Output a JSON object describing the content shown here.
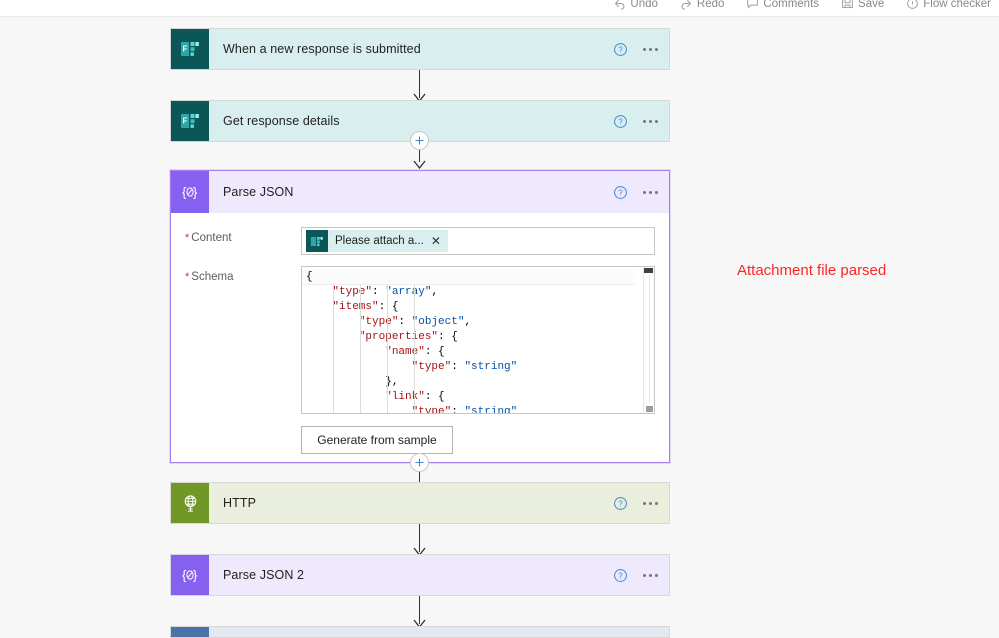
{
  "toolbar": {
    "items": [
      {
        "label": "Undo",
        "icon": "undo-icon"
      },
      {
        "label": "Redo",
        "icon": "redo-icon"
      },
      {
        "label": "Comments",
        "icon": "comment-icon"
      },
      {
        "label": "Save",
        "icon": "save-icon"
      },
      {
        "label": "Flow checker",
        "icon": "flow-checker-icon"
      }
    ]
  },
  "flow": {
    "steps": [
      {
        "title": "When a new response is submitted",
        "icon": "microsoft-forms-icon",
        "type": "forms"
      },
      {
        "title": "Get response details",
        "icon": "microsoft-forms-icon",
        "type": "forms"
      },
      {
        "title": "Parse JSON",
        "icon": "parse-json-icon",
        "type": "json"
      },
      {
        "title": "HTTP",
        "icon": "http-globe-icon",
        "type": "http"
      },
      {
        "title": "Parse JSON 2",
        "icon": "parse-json-icon",
        "type": "json"
      }
    ],
    "help_tooltip": "?",
    "more_menu": "..."
  },
  "parse_json": {
    "title": "Parse JSON",
    "content_label": "Content",
    "schema_label": "Schema",
    "required_marker": "*",
    "token": {
      "text": "Please attach a...",
      "remove": "✕",
      "icon": "microsoft-forms-icon"
    },
    "schema_lines": [
      [
        {
          "t": "{",
          "c": "p"
        }
      ],
      [
        {
          "t": "    ",
          "c": "p"
        },
        {
          "t": "\"type\"",
          "c": "k"
        },
        {
          "t": ": ",
          "c": "p"
        },
        {
          "t": "\"array\"",
          "c": "v"
        },
        {
          "t": ",",
          "c": "p"
        }
      ],
      [
        {
          "t": "    ",
          "c": "p"
        },
        {
          "t": "\"items\"",
          "c": "k"
        },
        {
          "t": ": {",
          "c": "p"
        }
      ],
      [
        {
          "t": "        ",
          "c": "p"
        },
        {
          "t": "\"type\"",
          "c": "k"
        },
        {
          "t": ": ",
          "c": "p"
        },
        {
          "t": "\"object\"",
          "c": "v"
        },
        {
          "t": ",",
          "c": "p"
        }
      ],
      [
        {
          "t": "        ",
          "c": "p"
        },
        {
          "t": "\"properties\"",
          "c": "k"
        },
        {
          "t": ": {",
          "c": "p"
        }
      ],
      [
        {
          "t": "            ",
          "c": "p"
        },
        {
          "t": "\"name\"",
          "c": "k"
        },
        {
          "t": ": {",
          "c": "p"
        }
      ],
      [
        {
          "t": "                ",
          "c": "p"
        },
        {
          "t": "\"type\"",
          "c": "k"
        },
        {
          "t": ": ",
          "c": "p"
        },
        {
          "t": "\"string\"",
          "c": "v"
        }
      ],
      [
        {
          "t": "            },",
          "c": "p"
        }
      ],
      [
        {
          "t": "            ",
          "c": "p"
        },
        {
          "t": "\"link\"",
          "c": "k"
        },
        {
          "t": ": {",
          "c": "p"
        }
      ],
      [
        {
          "t": "                ",
          "c": "p"
        },
        {
          "t": "\"type\"",
          "c": "k"
        },
        {
          "t": ": ",
          "c": "p"
        },
        {
          "t": "\"string\"",
          "c": "v"
        }
      ]
    ],
    "generate_button": "Generate from sample"
  },
  "annotation": {
    "text": "Attachment file parsed",
    "color": "#fb2727"
  },
  "colors": {
    "forms_tile": "#0b5757",
    "forms_card": "#d9eeee",
    "json_tile": "#8661f0",
    "json_card": "#eee9fd",
    "http_tile": "#709727",
    "http_card": "#e9efdc",
    "blue_tile": "#4a74a8",
    "blue_card": "#e3e9f1",
    "canvas": "#f7f7f7"
  }
}
